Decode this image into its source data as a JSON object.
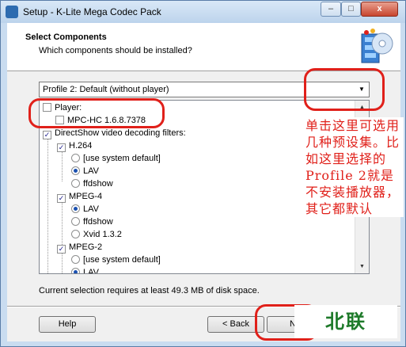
{
  "window": {
    "title": "Setup - K-Lite Mega Codec Pack",
    "controls": {
      "minimize": "–",
      "maximize": "□",
      "close": "x"
    }
  },
  "header": {
    "title": "Select Components",
    "subtitle": "Which components should be installed?"
  },
  "profile": {
    "selected": "Profile 2: Default (without player)"
  },
  "tree": [
    {
      "label": "Player:",
      "kind": "checkbox",
      "checked": false
    },
    {
      "label": "MPC-HC 1.6.8.7378",
      "kind": "checkbox",
      "checked": false
    },
    {
      "label": "DirectShow video decoding filters:",
      "kind": "checkbox",
      "checked": true
    },
    {
      "label": "H.264",
      "kind": "checkbox",
      "checked": true
    },
    {
      "label": "[use system default]",
      "kind": "radio",
      "checked": false
    },
    {
      "label": "LAV",
      "kind": "radio",
      "checked": true
    },
    {
      "label": "ffdshow",
      "kind": "radio",
      "checked": false
    },
    {
      "label": "MPEG-4",
      "kind": "checkbox",
      "checked": true
    },
    {
      "label": "LAV",
      "kind": "radio",
      "checked": true
    },
    {
      "label": "ffdshow",
      "kind": "radio",
      "checked": false
    },
    {
      "label": "Xvid 1.3.2",
      "kind": "radio",
      "checked": false
    },
    {
      "label": "MPEG-2",
      "kind": "checkbox",
      "checked": true
    },
    {
      "label": "[use system default]",
      "kind": "radio",
      "checked": false
    },
    {
      "label": "LAV",
      "kind": "radio",
      "checked": true
    }
  ],
  "status": "Current selection requires at least 49.3 MB of disk space.",
  "buttons": {
    "help": "Help",
    "back": "< Back",
    "next": "Ne"
  },
  "annotation": {
    "text": "单击这里可选用几种预设集。比如这里选择的Profile 2就是不安装播放器，其它都默认",
    "color": "#e0201a"
  },
  "watermark": "北联",
  "colors": {
    "accent": "#1a50b0",
    "annotation": "#e0201a",
    "watermark": "#1e7a2a"
  }
}
